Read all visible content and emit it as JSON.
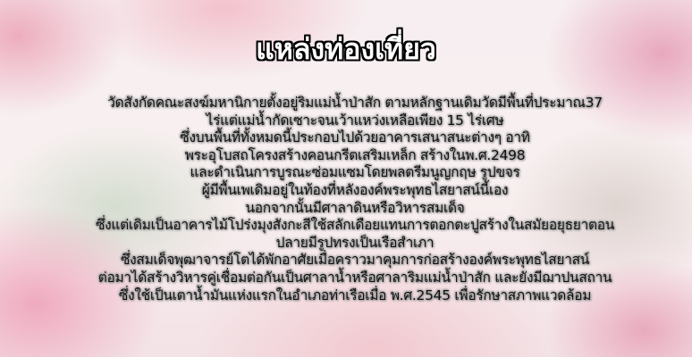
{
  "title": "แหล่งท่องเที่ยว",
  "lines": [
    "วัดสังกัดคณะสงฆ์มหานิกายตั้งอยู่ริมแม่น้ำป่าสัก ตามหลักฐานเดิมวัดมีพื้นที่ประมาณ37",
    "ไร่แต่แม่น้ำกัดเซาะจนเว้าแหว่งเหลือเพียง 15 ไร่เศษ",
    "ซึ่งบนพื้นที่ทั้งหมดนี้ประกอบไปด้วยอาคารเสนาสนะต่างๆ อาทิ",
    "พระอุโบสถโครงสร้างคอนกรีตเสริมเหล็ก สร้างในพ.ศ.2498",
    "และดำเนินการบูรณะซ่อมแซมโดยพลตรีมนูญกฤษ รูปขจร",
    "ผู้มีพื้นเพเดิมอยู่ในท้องที่หลังองค์พระพุทธไสยาสน์นี้เอง",
    "นอกจากนั้นมีศาลาดินหรือวิหารสมเด็จ",
    "ซึ่งแต่เดิมเป็นอาคารไม้โปร่งมุงสังกะสีใช้สลักเดือยแทนการตอกตะปูสร้างในสมัยอยุธยาตอน",
    "ปลายมีรูปทรงเป็นเรือสำเภา",
    "ซึ่งสมเด็จพุฒาจารย์โตได้พักอาศัยเมื่อคราวมาคุมการก่อสร้างองค์พระพุทธไสยาสน์",
    "ต่อมาได้สร้างวิหารคู่เชื่อมต่อกันเป็นศาลาน้ำหรือศาลาริมแม่น้ำป่าสัก และยังมีฌาปนสถาน",
    "ซึ่งใช้เป็นเตาน้ำมันแห่งแรกในอำเภอท่าเรือเมื่อ พ.ศ.2545 เพื่อรักษาสภาพแวดล้อม"
  ]
}
